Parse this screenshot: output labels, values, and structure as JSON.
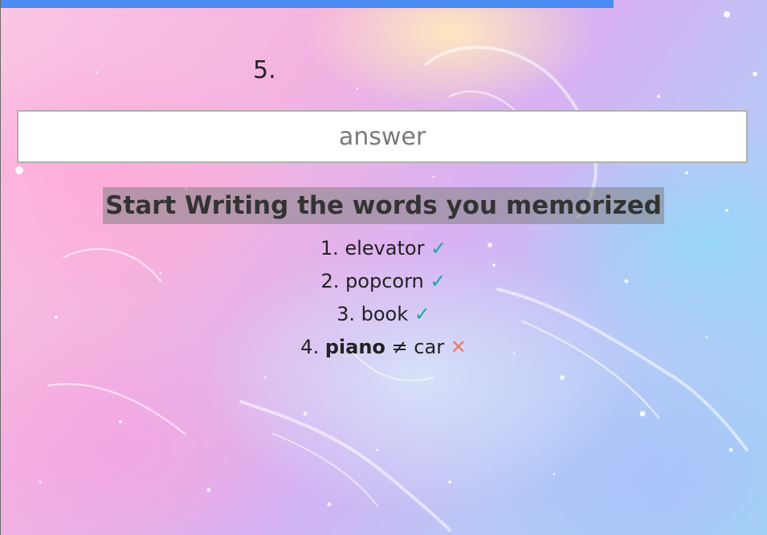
{
  "colors": {
    "top_bar": "#4b8bf4",
    "check": "#1aa89a",
    "cross": "#f07a60"
  },
  "question": {
    "number": "5."
  },
  "answer_input": {
    "placeholder": "answer",
    "value": ""
  },
  "instruction": "Start Writing the words you memorized",
  "results": [
    {
      "index": "1.",
      "word": "elevator",
      "mark": "✓",
      "icon": "check-icon"
    },
    {
      "index": "2.",
      "word": "popcorn",
      "mark": "✓",
      "icon": "check-icon"
    },
    {
      "index": "3.",
      "word": "book",
      "mark": "✓",
      "icon": "check-icon"
    },
    {
      "index": "4.",
      "attempt": "piano",
      "not_equal": "≠",
      "word": "car",
      "mark": "✕",
      "icon": "cross-icon"
    }
  ]
}
